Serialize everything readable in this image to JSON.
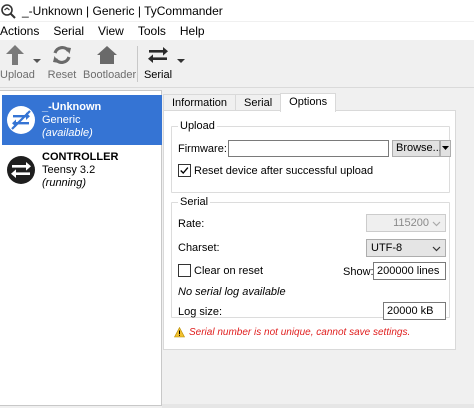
{
  "window": {
    "title": "_-Unknown | Generic | TyCommander"
  },
  "menu": [
    "Actions",
    "Serial",
    "View",
    "Tools",
    "Help"
  ],
  "toolbar": {
    "upload": "Upload",
    "reset": "Reset",
    "bootloader": "Bootloader",
    "serial": "Serial"
  },
  "devices": [
    {
      "name": "_-Unknown",
      "model": "Generic",
      "status": "(available)",
      "selected": true
    },
    {
      "name": "CONTROLLER",
      "model": "Teensy 3.2",
      "status": "(running)",
      "selected": false
    }
  ],
  "tabs": [
    "Information",
    "Serial",
    "Options"
  ],
  "active_tab": "Options",
  "upload_group": {
    "legend": "Upload",
    "firmware_label": "Firmware:",
    "firmware_value": "",
    "browse_label": "Browse...",
    "reset_after_upload_label": "Reset device after successful upload",
    "reset_after_upload_checked": true
  },
  "serial_group": {
    "legend": "Serial",
    "rate_label": "Rate:",
    "rate_value": "115200",
    "charset_label": "Charset:",
    "charset_value": "UTF-8",
    "clear_on_reset_label": "Clear on reset",
    "clear_on_reset_checked": false,
    "show_label": "Show:",
    "show_value": "200000 lines",
    "no_log_text": "No serial log available",
    "log_size_label": "Log size:",
    "log_size_value": "20000 kB"
  },
  "warning": "Serial number is not unique, cannot save settings.",
  "colors": {
    "selection": "#3574d4",
    "warning": "#e02020",
    "icon_dark": "#3b3b3b"
  }
}
